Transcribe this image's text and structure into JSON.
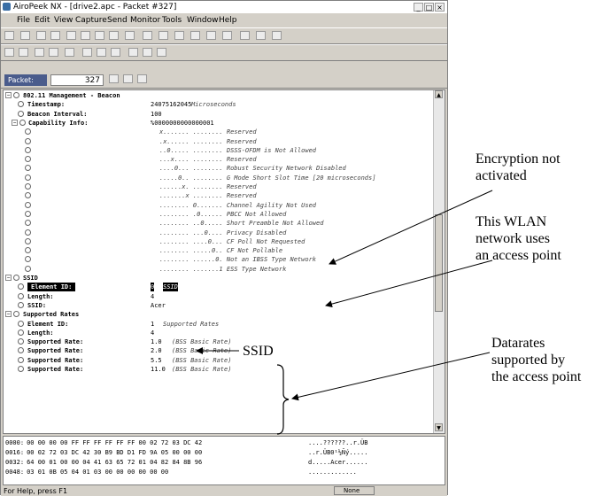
{
  "window": {
    "title": "AiroPeek NX - [drive2.apc - Packet #327]",
    "min": "_",
    "max": "□",
    "close": "×"
  },
  "menu": [
    "File",
    "Edit",
    "View",
    "Capture",
    "Send",
    "Monitor",
    "Tools",
    "Window",
    "Help"
  ],
  "packet_bar": {
    "label": "Packet:",
    "number": "327"
  },
  "decode": {
    "header": "802.11 Management - Beacon",
    "timestamp": {
      "label": "Timestamp:",
      "value": "24075162045",
      "desc": "Microseconds"
    },
    "beacon_interval": {
      "label": "Beacon Interval:",
      "value": "100"
    },
    "capability": {
      "label": "Capability Info:",
      "value": "%0000000000000001",
      "bits": [
        "x....... ........ Reserved",
        ".x...... ........ Reserved",
        "..0..... ........ DSSS-OFDM is Not Allowed",
        "...x.... ........ Reserved",
        "....0... ........ Robust Security Network Disabled",
        ".....0.. ........ G Mode Short Slot Time [20 microseconds]",
        "......x. ........ Reserved",
        ".......x ........ Reserved",
        "........ 0....... Channel Agility Not Used",
        "........ .0...... PBCC Not Allowed",
        "........ ..0..... Short Preamble Not Allowed",
        "........ ...0.... Privacy Disabled",
        "........ ....0... CF Poll Not Requested",
        "........ .....0.. CF Not Pollable",
        "........ ......0. Not an IBSS Type Network",
        "........ .......1 ESS Type Network"
      ]
    },
    "ssid": {
      "header": "SSID",
      "element_id": {
        "label": "Element ID:",
        "value": "0",
        "desc": "SSID"
      },
      "length": {
        "label": "Length:",
        "value": "4"
      },
      "ssid": {
        "label": "SSID:",
        "value": "Acer"
      }
    },
    "rates": {
      "header": "Supported Rates",
      "element_id": {
        "label": "Element ID:",
        "value": "1",
        "desc": "Supported Rates"
      },
      "length": {
        "label": "Length:",
        "value": "4"
      },
      "items": [
        {
          "label": "Supported Rate:",
          "value": "1.0",
          "desc": "(BSS Basic Rate)"
        },
        {
          "label": "Supported Rate:",
          "value": "2.0",
          "desc": "(BSS Basic Rate)"
        },
        {
          "label": "Supported Rate:",
          "value": "5.5",
          "desc": "(BSS Basic Rate)"
        },
        {
          "label": "Supported Rate:",
          "value": "11.0",
          "desc": "(BSS Basic Rate)"
        }
      ]
    }
  },
  "hex": [
    {
      "off": "0000:",
      "bytes": "00 00 00 00 FF FF FF FF FF FF 00 02 72 03 DC 42",
      "ascii": "....??????..r.ÜB"
    },
    {
      "off": "0016:",
      "bytes": "00 02 72 03 DC 42 30 B9 BD D1 FD 9A 05 00 00 00",
      "ascii": "..r.ÜB0¹½Ñý....."
    },
    {
      "off": "0032:",
      "bytes": "64 00 01 00 00 04 41 63 65 72 01 04 82 84 8B 96",
      "ascii": "d.....Acer......"
    },
    {
      "off": "0048:",
      "bytes": "03 01 0B 05 04 01 03 00 00 00 00 00 00",
      "ascii": "............."
    }
  ],
  "status": {
    "help": "For Help, press F1",
    "none": "None"
  },
  "annotations": {
    "encryption": "Encryption not\nactivated",
    "wlan": "This WLAN\nnetwork uses\nan access point",
    "ssid": "SSID",
    "datarates": "Datarates\nsupported by\nthe access point"
  },
  "icons": {
    "toolbar": [
      "new-icon",
      "open-icon",
      "save-icon",
      "print-icon",
      "copy-icon",
      "paste-icon",
      "find-icon",
      "filter-icon",
      "stats-icon",
      "start-capture-icon",
      "back-icon",
      "forward-icon",
      "hex-icon",
      "ascii-icon",
      "decode-icon",
      "node-icon",
      "chart-icon"
    ]
  }
}
